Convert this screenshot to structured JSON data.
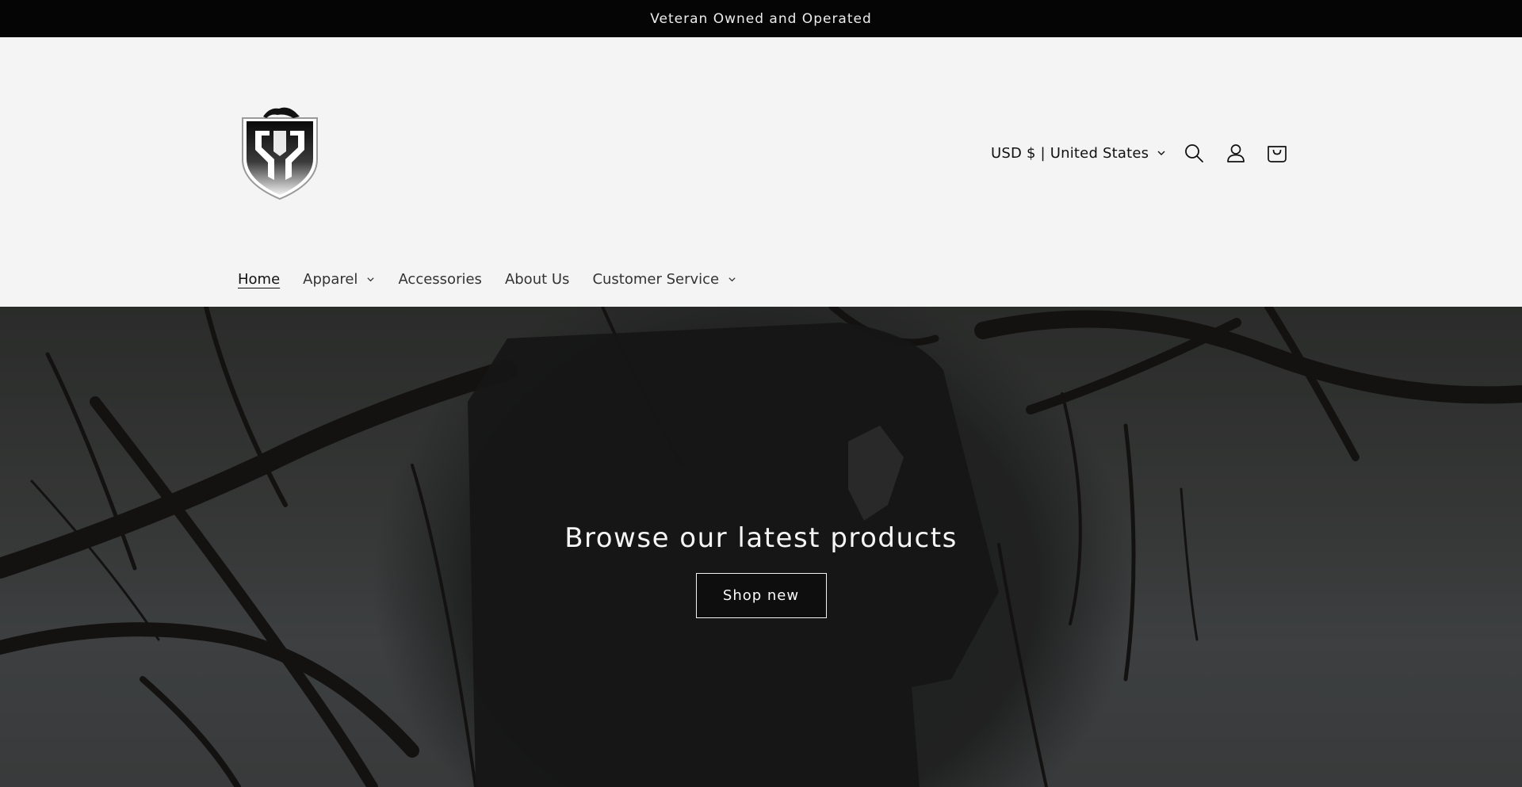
{
  "announcement": {
    "text": "Veteran Owned and Operated"
  },
  "header": {
    "logo_alt": "Shield logo",
    "currency": "USD $ | United States",
    "icons": [
      "search-icon",
      "account-icon",
      "cart-icon"
    ]
  },
  "nav": {
    "items": [
      {
        "label": "Home",
        "active": true,
        "dropdown": false
      },
      {
        "label": "Apparel",
        "active": false,
        "dropdown": true
      },
      {
        "label": "Accessories",
        "active": false,
        "dropdown": false
      },
      {
        "label": "About Us",
        "active": false,
        "dropdown": false
      },
      {
        "label": "Customer Service",
        "active": false,
        "dropdown": true
      }
    ]
  },
  "hero": {
    "title": "Browse our latest products",
    "button_label": "Shop new"
  },
  "colors": {
    "announcement_bg": "#050505",
    "header_bg": "#f4f4f4",
    "text": "#1a1a1a"
  }
}
